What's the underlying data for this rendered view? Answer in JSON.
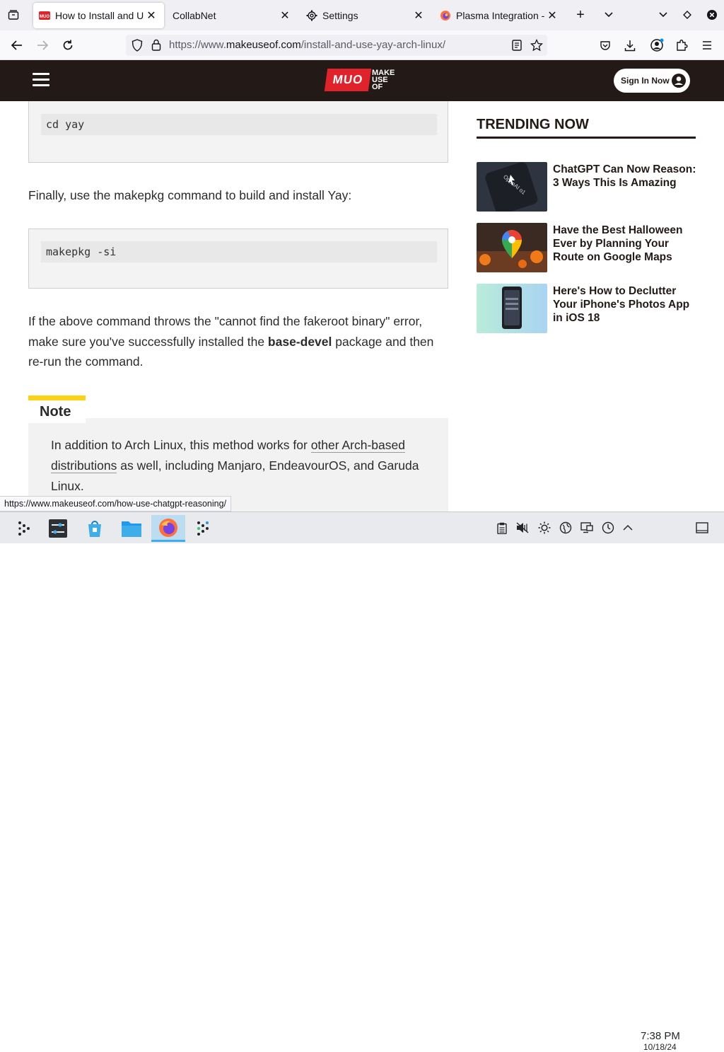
{
  "browser": {
    "tabs": [
      {
        "label": "How to Install and Us",
        "favicon": "muo-favicon",
        "active": true
      },
      {
        "label": "CollabNet",
        "favicon": "",
        "active": false
      },
      {
        "label": "Settings",
        "favicon": "gear-icon",
        "active": false
      },
      {
        "label": "Plasma Integration -",
        "favicon": "firefox-icon",
        "active": false
      }
    ],
    "url_prefix": "https://www.",
    "url_domain": "makeuseof.com",
    "url_path": "/install-and-use-yay-arch-linux/",
    "status_url": "https://www.makeuseof.com/how-use-chatgpt-reasoning/"
  },
  "site": {
    "logo_box": "MUO",
    "logo_text": "MAKE USE OF",
    "sign_in": "Sign In Now",
    "brand_color": "#e0232b",
    "header_color": "#231a17"
  },
  "article": {
    "code1": "cd yay",
    "para1": "Finally, use the makepkg command to build and install Yay:",
    "code2": "makepkg -si",
    "para2_a": "If the above command throws the \"cannot find the fakeroot binary\" error, make sure you've successfully installed the ",
    "para2_bold": "base-devel",
    "para2_b": " package and then re-run the command.",
    "note_title": "Note",
    "note_a": "In addition to Arch Linux, this method works for ",
    "note_link": "other Arch-based distributions",
    "note_b": " as well, including Manjaro, EndeavourOS, and Garuda Linux."
  },
  "trending": {
    "title": "TRENDING NOW",
    "items": [
      {
        "title": "ChatGPT Can Now Reason: 3 Ways This Is Amazing"
      },
      {
        "title": "Have the Best Halloween Ever by Planning Your Route on Google Maps"
      },
      {
        "title": "Here's How to Declutter Your iPhone's Photos App in iOS 18"
      }
    ]
  },
  "taskbar": {
    "time": "7:38 PM",
    "date": "10/18/24"
  }
}
